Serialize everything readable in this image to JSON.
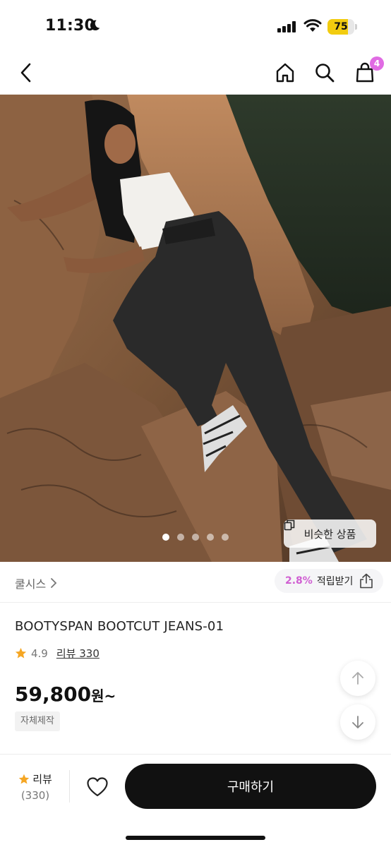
{
  "status_bar": {
    "time": "11:30",
    "battery_level": "75",
    "battery_fraction": 0.75
  },
  "nav": {
    "cart_count": "4",
    "icons": [
      "chevron-left-icon",
      "home-icon",
      "search-icon",
      "shopping-bag-icon"
    ],
    "badge_color": "#e06be3"
  },
  "hero": {
    "image_description_icon": "product-photo",
    "carousel_count": 5,
    "carousel_active_index": 0,
    "similar_button_label": "비슷한 상품"
  },
  "brand": {
    "name": "쿨시스",
    "points_rate": "2.8%",
    "points_label": "적립받기"
  },
  "product": {
    "title": "BOOTYSPAN BOOTCUT JEANS-01",
    "rating": "4.9",
    "review_label": "리뷰 330",
    "price": "59,800",
    "price_unit": "원~",
    "tag": "자체제작"
  },
  "bottom_bar": {
    "review_label": "리뷰",
    "review_count": "(330)",
    "buy_label": "구매하기"
  },
  "colors": {
    "accent": "#d05fd2",
    "star": "#f5a623",
    "buy_button": "#111111"
  }
}
